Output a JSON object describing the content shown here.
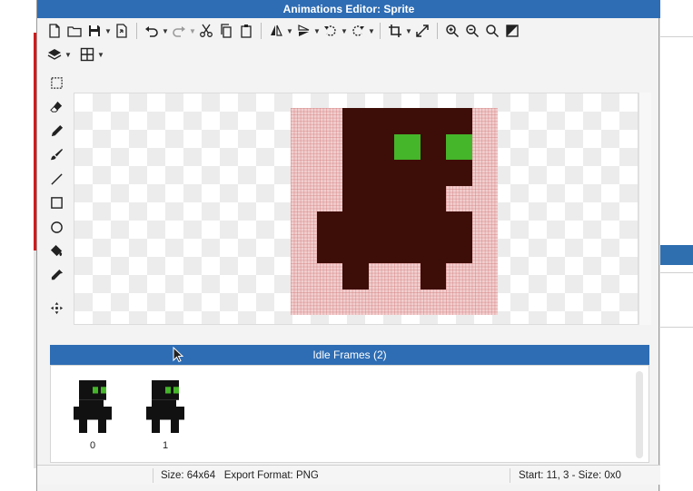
{
  "window": {
    "title": "Animations Editor: Sprite"
  },
  "frames_panel": {
    "title": "Idle Frames (2)",
    "frames": [
      {
        "label": "0"
      },
      {
        "label": "1"
      }
    ]
  },
  "status": {
    "size_label": "Size: 64x64",
    "export_label": "Export Format: PNG",
    "selection_label": "Start: 11, 3 - Size: 0x0"
  },
  "colors": {
    "title_bar": "#2e6db4",
    "sprite_body": "#3d0d07",
    "sprite_background": "#f2cfcf",
    "sprite_eyes": "#45b52a",
    "thumb_body": "#111111"
  },
  "icons": {
    "toolbar_row1": [
      "new-file-icon",
      "open-folder-icon",
      "save-icon",
      "export-icon",
      "undo-icon",
      "redo-icon",
      "cut-icon",
      "copy-icon",
      "paste-icon",
      "flip-horizontal-icon",
      "flip-vertical-icon",
      "rotate-left-icon",
      "rotate-right-icon",
      "crop-icon",
      "resize-icon",
      "zoom-in-icon",
      "zoom-out-icon",
      "zoom-fit-icon",
      "invert-icon"
    ],
    "toolbar_row2": [
      "layers-icon",
      "grid-icon"
    ],
    "palette": [
      "marquee-icon",
      "eraser-icon",
      "pencil-icon",
      "brush-icon",
      "line-icon",
      "rectangle-icon",
      "ellipse-icon",
      "fill-bucket-icon",
      "eyedropper-icon",
      "move-icon"
    ]
  }
}
